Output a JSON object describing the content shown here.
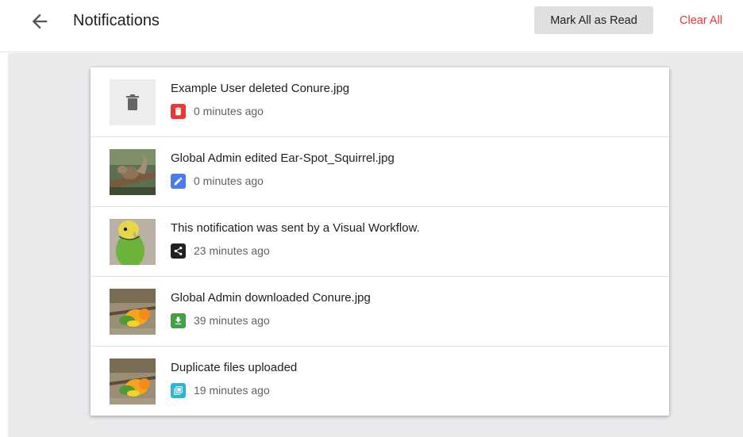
{
  "header": {
    "title": "Notifications",
    "mark_all_label": "Mark All as Read",
    "clear_all_label": "Clear All"
  },
  "colors": {
    "accent_red": "#e53935",
    "delete": "#e53935",
    "edit": "#4a7cf0",
    "workflow": "#212121",
    "download": "#43a047",
    "duplicate": "#29b6d6"
  },
  "notifications": [
    {
      "message": "Example User deleted Conure.jpg",
      "time": "0 minutes ago",
      "type_icon": "trash-icon",
      "thumbnail": "deleted-placeholder"
    },
    {
      "message": "Global Admin edited Ear-Spot_Squirrel.jpg",
      "time": "0 minutes ago",
      "type_icon": "pencil-icon",
      "thumbnail": "squirrel"
    },
    {
      "message": "This notification was sent by a Visual Workflow.",
      "time": "23 minutes ago",
      "type_icon": "share-icon",
      "thumbnail": "parakeet"
    },
    {
      "message": "Global Admin downloaded Conure.jpg",
      "time": "39 minutes ago",
      "type_icon": "download-icon",
      "thumbnail": "conure"
    },
    {
      "message": "Duplicate files uploaded",
      "time": "19 minutes ago",
      "type_icon": "duplicate-icon",
      "thumbnail": "conure"
    }
  ]
}
